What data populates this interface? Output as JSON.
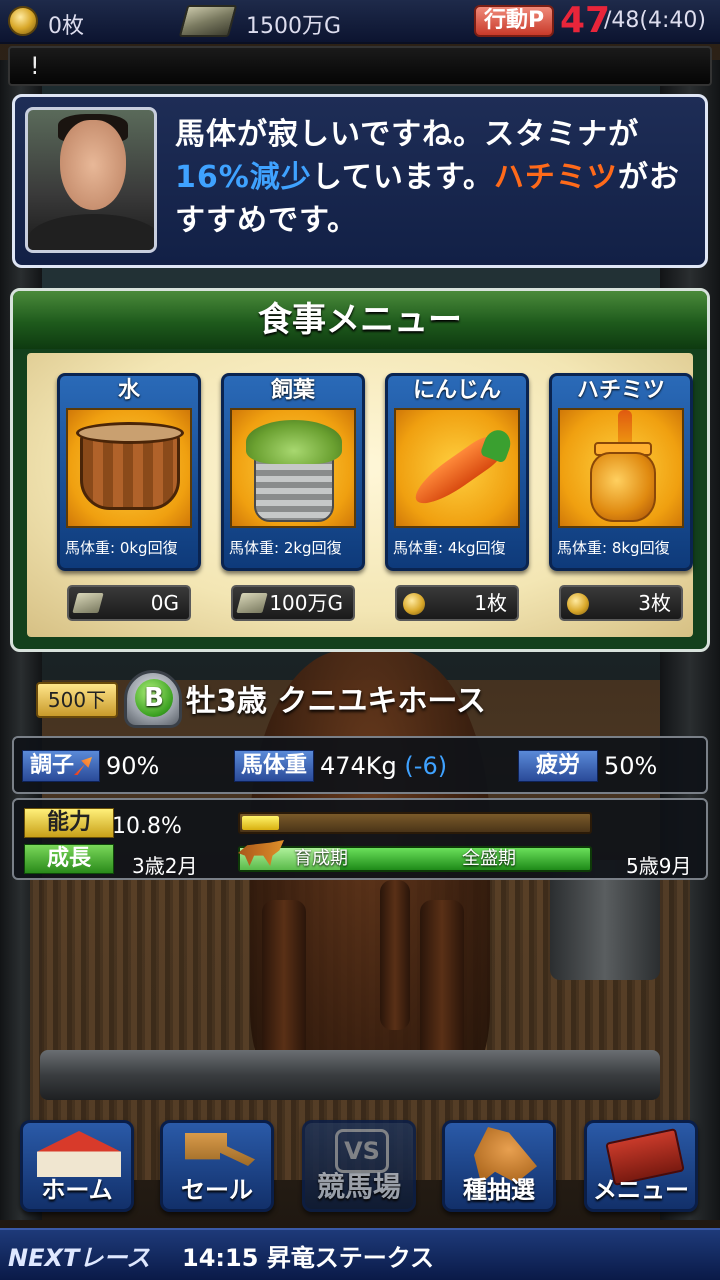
{
  "status_bar": {
    "coins": "0枚",
    "money": "1500万G",
    "action_label": "行動P",
    "action_value": "47",
    "action_max": "/48(4:40)"
  },
  "ticker": {
    "text": "!"
  },
  "advisor": {
    "text_part1": "馬体が寂しいですね。スタミナが",
    "text_pct": "16%減少",
    "text_part2": "しています。",
    "text_item": "ハチミツ",
    "text_part3": "がおすすめです。"
  },
  "food_menu": {
    "title": "食事メニュー",
    "items": [
      {
        "name": "水",
        "weight": "馬体重: 0kg回復",
        "price": "0G",
        "price_icon": "money-icon"
      },
      {
        "name": "飼葉",
        "weight": "馬体重: 2kg回復",
        "price": "100万G",
        "price_icon": "money-icon"
      },
      {
        "name": "にんじん",
        "weight": "馬体重: 4kg回復",
        "price": "1枚",
        "price_icon": "coin-icon"
      },
      {
        "name": "ハチミツ",
        "weight": "馬体重: 8kg回復",
        "price": "3枚",
        "price_icon": "coin-icon"
      }
    ]
  },
  "horse": {
    "rank": "500下",
    "grade": "B",
    "name": "牡3歳 クニユキホース"
  },
  "stats": {
    "condition_label": "調子",
    "condition_value": "90%",
    "weight_label": "馬体重",
    "weight_value": "474Kg",
    "weight_delta": "(-6)",
    "fatigue_label": "疲労",
    "fatigue_value": "50%"
  },
  "growth": {
    "ability_label": "能力",
    "ability_value": "10.8%",
    "ability_fraction": 0.108,
    "growth_label": "成長",
    "start_age": "3歳2月",
    "phase1": "育成期",
    "phase2": "全盛期",
    "end_age": "5歳9月"
  },
  "nav": {
    "home": "ホーム",
    "sale": "セール",
    "race": "競馬場",
    "race_icon": "VS",
    "stud": "種抽選",
    "menu": "メニュー"
  },
  "next_race": {
    "label": "NEXTレース",
    "info": "14:15 昇竜ステークス"
  },
  "colors": {
    "accent_red": "#e8253a",
    "highlight_blue": "#3fa2ff",
    "highlight_orange": "#ff6a1a"
  }
}
